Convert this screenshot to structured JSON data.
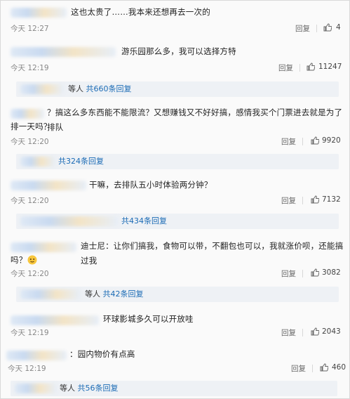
{
  "comments": [
    {
      "text": "这也太贵了……我本来还想再去一次的",
      "time": "今天 12:27",
      "reply": "回复",
      "likes": "4"
    },
    {
      "text": "游乐园那么多，我可以选择方特",
      "time": "今天 12:19",
      "reply": "回复",
      "likes": "11247",
      "sub": {
        "prefix": "等人",
        "count": "共660条回复"
      }
    },
    {
      "text": "？搞这么多东西能不能限流？又想赚钱又不好好搞，感情我买个门票进去就是为了排队",
      "text2": "排一天吗？",
      "time": "今天 12:20",
      "reply": "回复",
      "likes": "9920",
      "sub": {
        "prefix": "",
        "count": "共324条回复"
      }
    },
    {
      "text": "干嘛，去排队五小时体验两分钟？",
      "time": "今天 12:20",
      "reply": "回复",
      "likes": "7132",
      "sub": {
        "prefix": "",
        "count": "共434条回复"
      }
    },
    {
      "text": "迪士尼：让你们搞我，食物可以带，不翻包也可以，我就涨价呗，还能搞过我",
      "text2": "吗？",
      "time": "今天 12:20",
      "reply": "回复",
      "likes": "3082",
      "sub": {
        "prefix": "等人",
        "count": "共42条回复"
      }
    },
    {
      "text": "环球影城多久可以开放哇",
      "time": "今天 12:19",
      "reply": "回复",
      "likes": "2043"
    },
    {
      "text": "：园内物价有点高",
      "time": "今天 12:19",
      "reply": "回复",
      "likes": "460",
      "sub": {
        "prefix": "等人",
        "count": "共56条回复"
      }
    }
  ],
  "colors": {
    "link": "#1b6bb5",
    "meta": "#888888"
  },
  "icons": {
    "like": "thumbs-up-icon",
    "emoji": "smiley-emoji-icon"
  }
}
